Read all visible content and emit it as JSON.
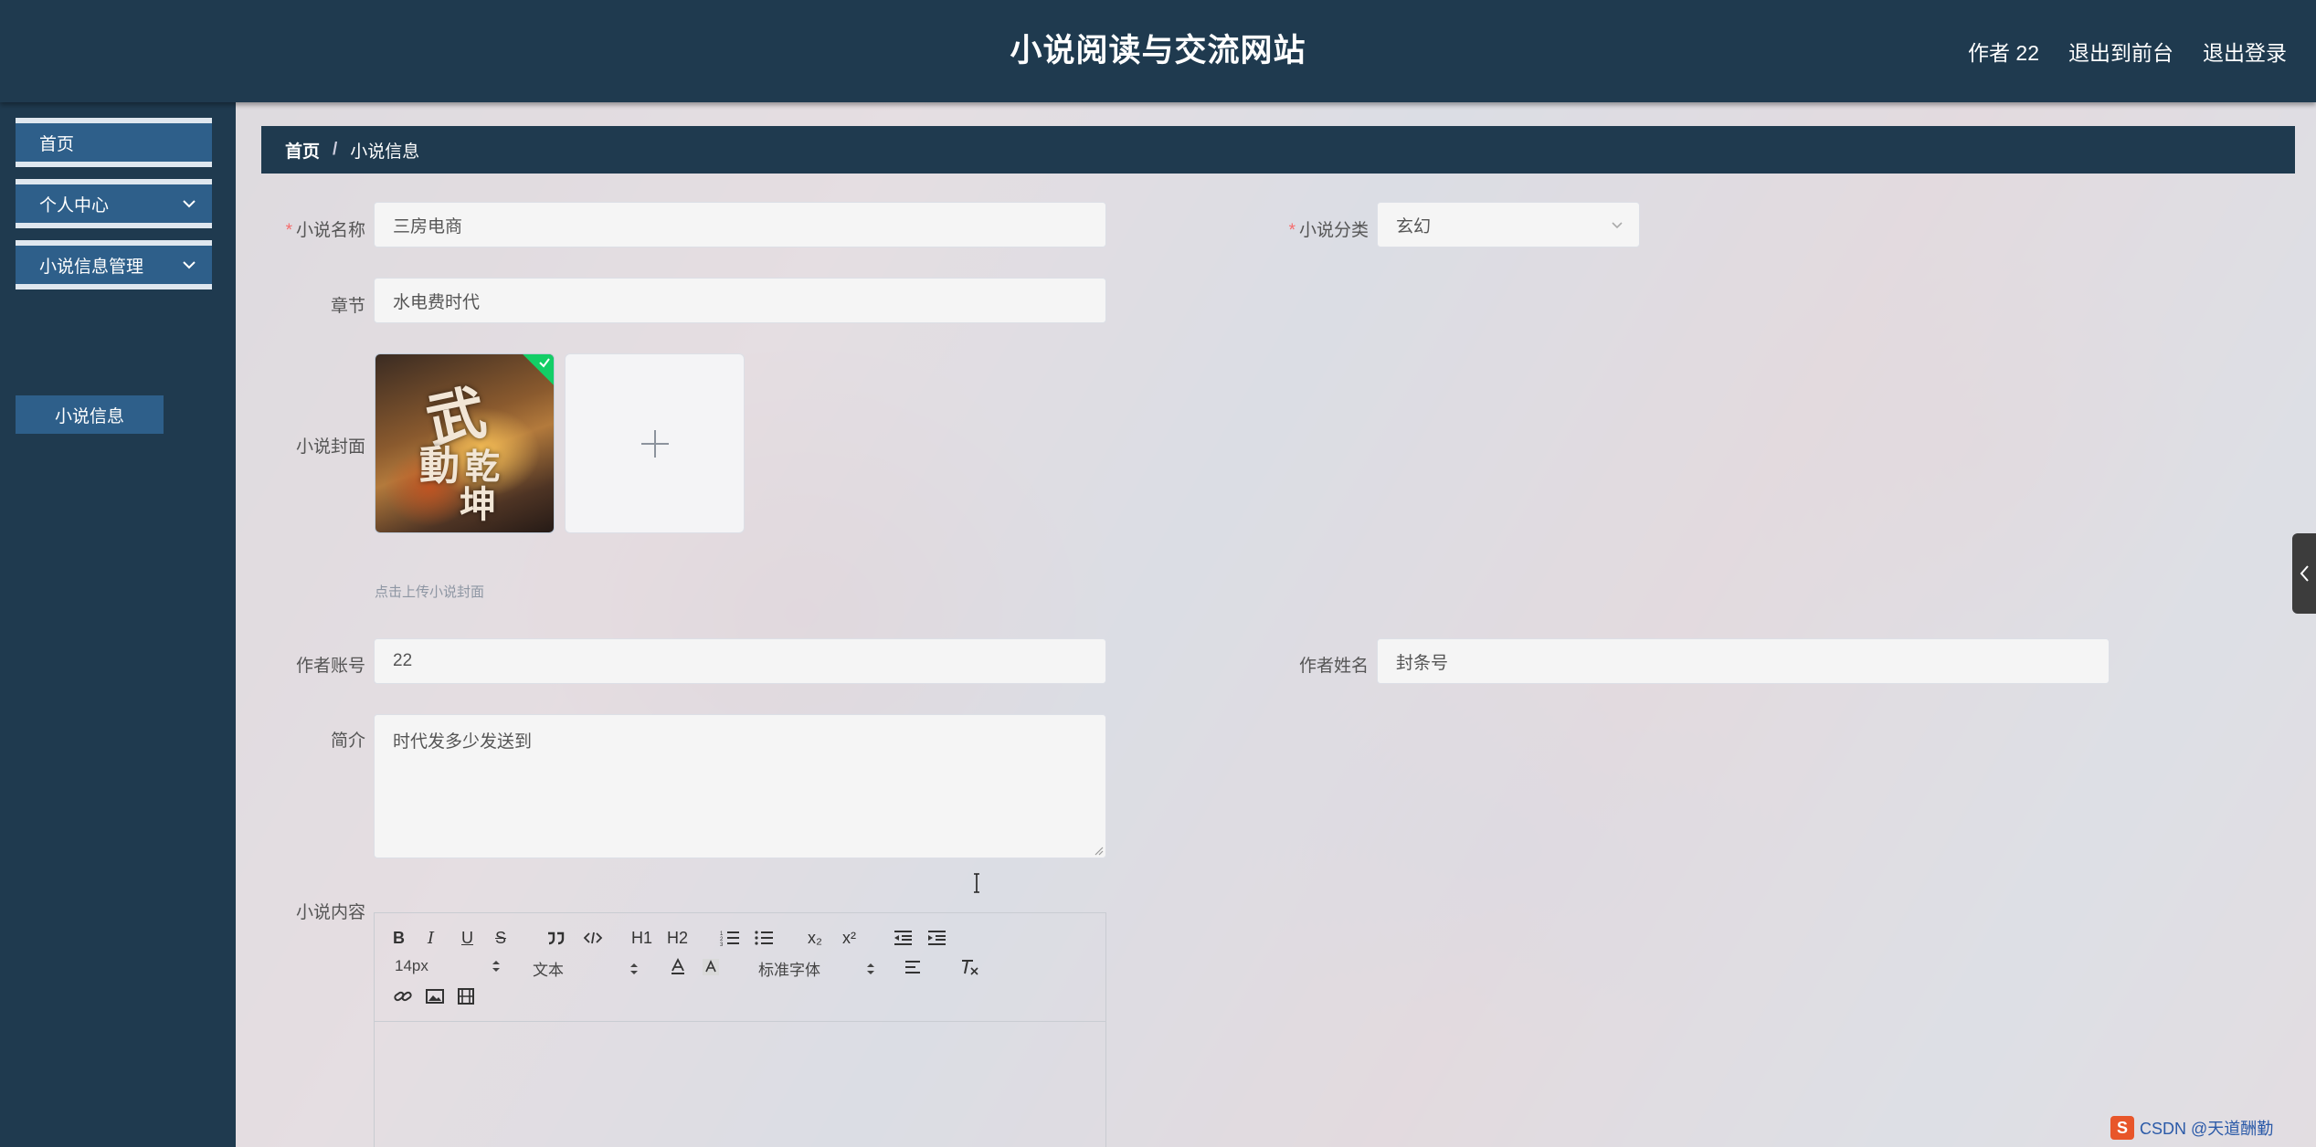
{
  "header": {
    "title": "小说阅读与交流网站",
    "user": "作者 22",
    "to_front": "退出到前台",
    "logout": "退出登录"
  },
  "sidebar": {
    "items": [
      {
        "label": "首页"
      },
      {
        "label": "个人中心"
      },
      {
        "label": "小说信息管理"
      }
    ],
    "sub_items": [
      {
        "label": "小说信息"
      }
    ]
  },
  "breadcrumb": {
    "home": "首页",
    "separator": "/",
    "current": "小说信息"
  },
  "form": {
    "novel_name_label": "小说名称",
    "novel_name_value": "三房电商",
    "category_label": "小说分类",
    "category_value": "玄幻",
    "chapter_label": "章节",
    "chapter_value": "水电费时代",
    "cover_label": "小说封面",
    "cover_hint": "点击上传小说封面",
    "author_account_label": "作者账号",
    "author_account_value": "22",
    "author_name_label": "作者姓名",
    "author_name_value": "封条号",
    "intro_label": "简介",
    "intro_value": "时代发多少发送到",
    "content_label": "小说内容"
  },
  "editor": {
    "buttons": [
      "B",
      "I",
      "U",
      "S"
    ],
    "heading1": "H1",
    "heading2": "H2",
    "sub": "x₂",
    "sup": "x²",
    "font_size": "14px",
    "format": "文本",
    "font_family": "标准字体"
  },
  "watermark": "CSDN @天道酬勤",
  "colors": {
    "header_bg": "#1f3a4f",
    "menu_bg": "#2e5f8a",
    "required": "#f56c6c",
    "success": "#13ce66"
  }
}
